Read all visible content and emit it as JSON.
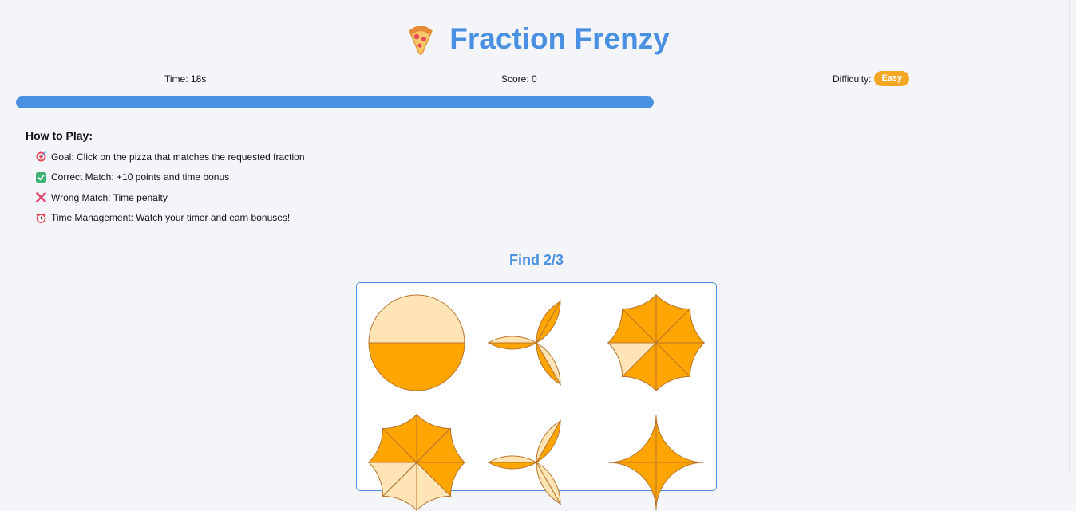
{
  "header": {
    "title": "Fraction Frenzy",
    "icon": "pizza-icon"
  },
  "stats": {
    "time_text": "Time: 18s",
    "score_text": "Score: 0",
    "difficulty_label": "Difficulty:",
    "difficulty_value": "Easy"
  },
  "timer_progress_fraction": 1.0,
  "instructions": {
    "title": "How to Play:",
    "items": [
      {
        "icon": "target-icon",
        "text": "Goal: Click on the pizza that matches the requested fraction"
      },
      {
        "icon": "check-icon",
        "text": "Correct Match: +10 points and time bonus"
      },
      {
        "icon": "cross-icon",
        "text": "Wrong Match: Time penalty"
      },
      {
        "icon": "alarm-clock-icon",
        "text": "Time Management: Watch your timer and earn bonuses!"
      }
    ]
  },
  "prompt": "Find 2/3",
  "pizzas": [
    {
      "numerator": 1,
      "denominator": 2
    },
    {
      "numerator": 2,
      "denominator": 3
    },
    {
      "numerator": 7,
      "denominator": 8
    },
    {
      "numerator": 5,
      "denominator": 8
    },
    {
      "numerator": 1,
      "denominator": 3
    },
    {
      "numerator": 4,
      "denominator": 4
    }
  ],
  "colors": {
    "accent": "#4a90e2",
    "badge": "#f5a623",
    "slice_filled": "#ffa500",
    "slice_empty": "#ffe4b5",
    "slice_stroke": "#b8742c"
  }
}
